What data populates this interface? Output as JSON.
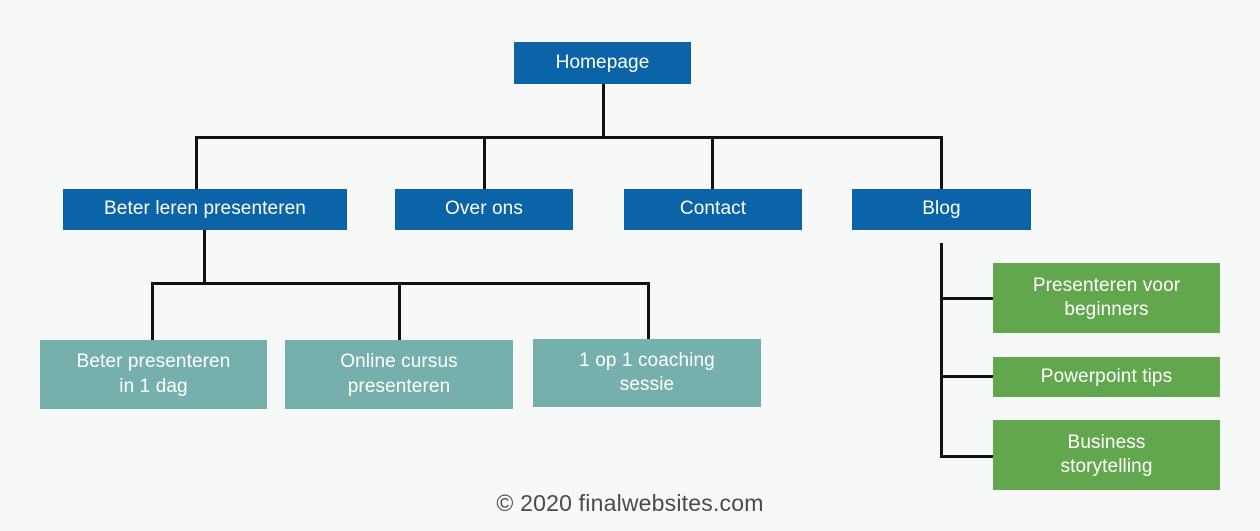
{
  "diagram": {
    "type": "sitemap-tree",
    "background_color": "#f7f8f8",
    "colors": {
      "level1": "#0b63a8",
      "level2": "#0b63a8",
      "level3": "#76b0ad",
      "blog_child": "#62a74d",
      "connector": "#111111",
      "node_text": "#ffffff",
      "footer_text": "#4a4a4a"
    },
    "root": {
      "label": "Homepage"
    },
    "level2": [
      {
        "label": "Beter leren presenteren"
      },
      {
        "label": "Over ons"
      },
      {
        "label": "Contact"
      },
      {
        "label": "Blog"
      }
    ],
    "level3": [
      {
        "label": "Beter presenteren\nin 1 dag",
        "line1": "Beter presenteren",
        "line2": "in 1 dag"
      },
      {
        "label": "Online cursus\npresenteren",
        "line1": "Online cursus",
        "line2": "presenteren"
      },
      {
        "label": "1 op 1 coaching\nsessie",
        "line1": "1 op 1 coaching",
        "line2": "sessie"
      }
    ],
    "blog_children": [
      {
        "label": "Presenteren voor\nbeginners",
        "line1": "Presenteren voor",
        "line2": "beginners"
      },
      {
        "label": "Powerpoint tips",
        "line1": "Powerpoint tips",
        "line2": ""
      },
      {
        "label": "Business\nstorytelling",
        "line1": "Business",
        "line2": "storytelling"
      }
    ]
  },
  "footer": {
    "credit": "© 2020 finalwebsites.com"
  }
}
